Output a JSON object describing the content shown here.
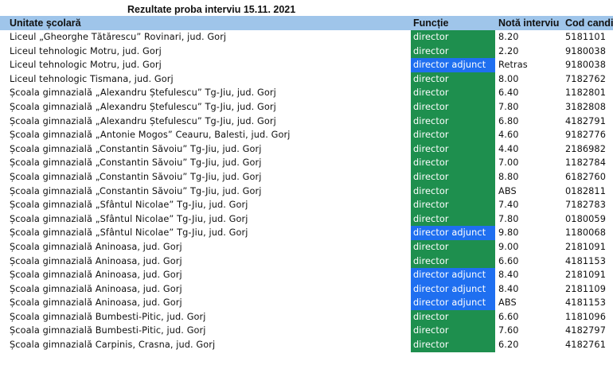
{
  "title": "Rezultate proba interviu 15.11. 2021",
  "colors": {
    "header_bg": "#9fc5ea",
    "director": "#1e8f4e",
    "director_adjunct": "#1f6ff0"
  },
  "columns": [
    "Unitate școlară",
    "Funcție",
    "Notă interviu",
    "Cod candid"
  ],
  "rows": [
    {
      "unit": "Liceul „Gheorghe Tătărescu” Rovinari, jud. Gorj",
      "role": "director",
      "grade": "8.20",
      "code": "5181101"
    },
    {
      "unit": "Liceul tehnologic Motru, jud. Gorj",
      "role": "director",
      "grade": "2.20",
      "code": "9180038"
    },
    {
      "unit": "Liceul tehnologic Motru, jud. Gorj",
      "role": "director adjunct",
      "grade": "Retras",
      "code": "9180038"
    },
    {
      "unit": "Liceul tehnologic Tismana, jud. Gorj",
      "role": "director",
      "grade": "8.00",
      "code": "7182762"
    },
    {
      "unit": "Școala gimnazială „Alexandru Ștefulescu” Tg-Jiu, jud. Gorj",
      "role": "director",
      "grade": "6.40",
      "code": "1182801"
    },
    {
      "unit": "Școala gimnazială „Alexandru Ștefulescu” Tg-Jiu, jud. Gorj",
      "role": "director",
      "grade": "7.80",
      "code": "3182808"
    },
    {
      "unit": "Școala gimnazială „Alexandru Ștefulescu” Tg-Jiu, jud. Gorj",
      "role": "director",
      "grade": "6.80",
      "code": "4182791"
    },
    {
      "unit": "Școala gimnazială „Antonie Mogos” Ceauru, Balesti, jud. Gorj",
      "role": "director",
      "grade": "4.60",
      "code": "9182776"
    },
    {
      "unit": "Școala gimnazială „Constantin Săvoiu” Tg-Jiu, jud. Gorj",
      "role": "director",
      "grade": "4.40",
      "code": "2186982"
    },
    {
      "unit": "Școala gimnazială „Constantin Săvoiu” Tg-Jiu, jud. Gorj",
      "role": "director",
      "grade": "7.00",
      "code": "1182784"
    },
    {
      "unit": "Școala gimnazială „Constantin Săvoiu” Tg-Jiu, jud. Gorj",
      "role": "director",
      "grade": "8.80",
      "code": "6182760"
    },
    {
      "unit": "Școala gimnazială „Constantin Săvoiu” Tg-Jiu, jud. Gorj",
      "role": "director",
      "grade": "ABS",
      "code": "0182811"
    },
    {
      "unit": "Școala gimnazială „Sfântul Nicolae” Tg-Jiu, jud. Gorj",
      "role": "director",
      "grade": "7.40",
      "code": "7182783"
    },
    {
      "unit": "Școala gimnazială „Sfântul Nicolae” Tg-Jiu, jud. Gorj",
      "role": "director",
      "grade": "7.80",
      "code": "0180059"
    },
    {
      "unit": "Școala gimnazială „Sfântul Nicolae” Tg-Jiu, jud. Gorj",
      "role": "director adjunct",
      "grade": "9.80",
      "code": "1180068"
    },
    {
      "unit": "Școala gimnazială Aninoasa, jud. Gorj",
      "role": "director",
      "grade": "9.00",
      "code": "2181091"
    },
    {
      "unit": "Școala gimnazială Aninoasa, jud. Gorj",
      "role": "director",
      "grade": "6.60",
      "code": "4181153"
    },
    {
      "unit": "Școala gimnazială Aninoasa, jud. Gorj",
      "role": "director adjunct",
      "grade": "8.40",
      "code": "2181091"
    },
    {
      "unit": "Școala gimnazială Aninoasa, jud. Gorj",
      "role": "director adjunct",
      "grade": "8.40",
      "code": "2181109"
    },
    {
      "unit": "Școala gimnazială Aninoasa, jud. Gorj",
      "role": "director adjunct",
      "grade": "ABS",
      "code": "4181153"
    },
    {
      "unit": "Școala gimnazială Bumbesti-Pitic, jud. Gorj",
      "role": "director",
      "grade": "6.60",
      "code": "1181096"
    },
    {
      "unit": "Școala gimnazială Bumbesti-Pitic, jud. Gorj",
      "role": "director",
      "grade": "7.60",
      "code": "4182797"
    },
    {
      "unit": "Școala gimnazială Carpinis, Crasna, jud. Gorj",
      "role": "director",
      "grade": "6.20",
      "code": "4182761"
    }
  ]
}
